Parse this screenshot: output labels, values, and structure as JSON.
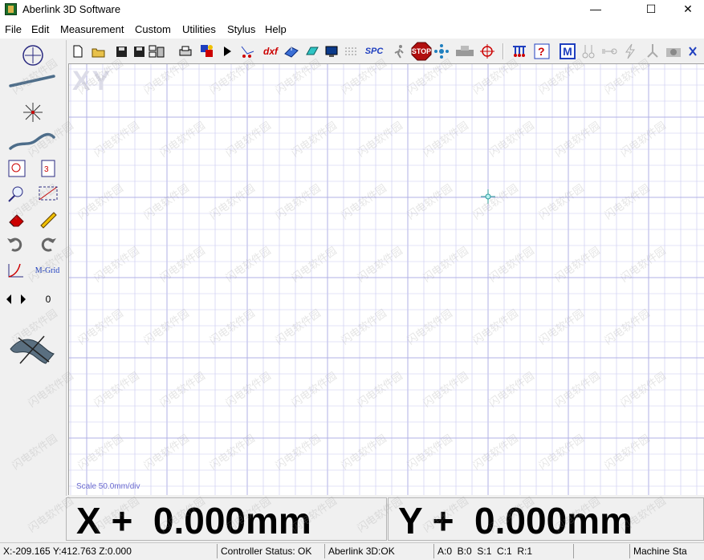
{
  "window": {
    "title": "Aberlink 3D Software",
    "minimize_glyph": "—",
    "maximize_glyph": "☐",
    "close_glyph": "✕"
  },
  "menu": {
    "items": [
      {
        "label": "File",
        "mnemonic": "F"
      },
      {
        "label": "Edit",
        "mnemonic": "E"
      },
      {
        "label": "Measurement",
        "mnemonic": "M"
      },
      {
        "label": "Custom",
        "mnemonic": "C"
      },
      {
        "label": "Utilities",
        "mnemonic": "U"
      },
      {
        "label": "Stylus",
        "mnemonic": "S"
      },
      {
        "label": "Help",
        "mnemonic": "H"
      }
    ]
  },
  "toolbar": {
    "dxf_label": "dxf",
    "spc_label": "SPC",
    "stop_label": "STOP",
    "m_label": "M"
  },
  "left_panel": {
    "mgrid_label": "M-Grid",
    "counter_value": "0"
  },
  "canvas": {
    "view_label": "XY",
    "scale_label": "Scale 50.0mm/div",
    "grid_color": "#c8c8f0",
    "major_grid_color": "#b0b0e6",
    "crosshair_color": "#2a9a9a"
  },
  "readouts": {
    "x_text": "X +  0.000mm",
    "y_text": "Y +  0.000mm"
  },
  "status": {
    "coordinates": "X:-209.165 Y:412.763 Z:0.000",
    "controller": "Controller Status: OK",
    "app_status": "Aberlink 3D:OK",
    "axes_state": "A:0  B:0  S:1  C:1  R:1",
    "machine": "Machine Sta"
  },
  "watermark_text": "闪电软件园",
  "colors": {
    "accent_red": "#cc0000",
    "accent_blue": "#1f3fbf",
    "stop_red": "#b10f0f"
  }
}
